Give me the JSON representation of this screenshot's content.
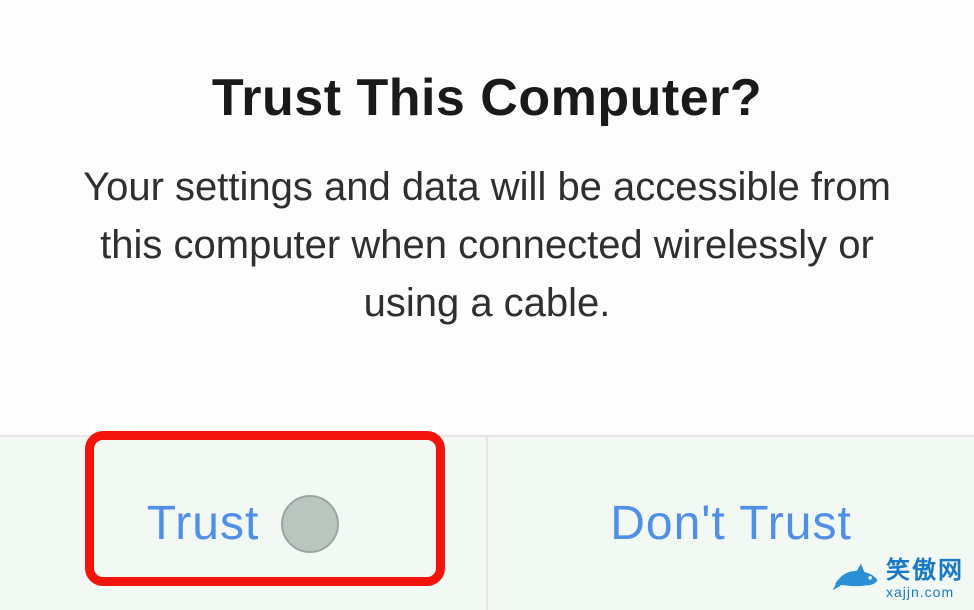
{
  "dialog": {
    "title": "Trust This Computer?",
    "message": "Your settings and data will be accessible from this computer when connected wirelessly or using a cable.",
    "actions": {
      "trust": "Trust",
      "dont_trust": "Don't Trust"
    }
  },
  "watermark": {
    "cn": "笑傲网",
    "url": "xajjn.com"
  }
}
